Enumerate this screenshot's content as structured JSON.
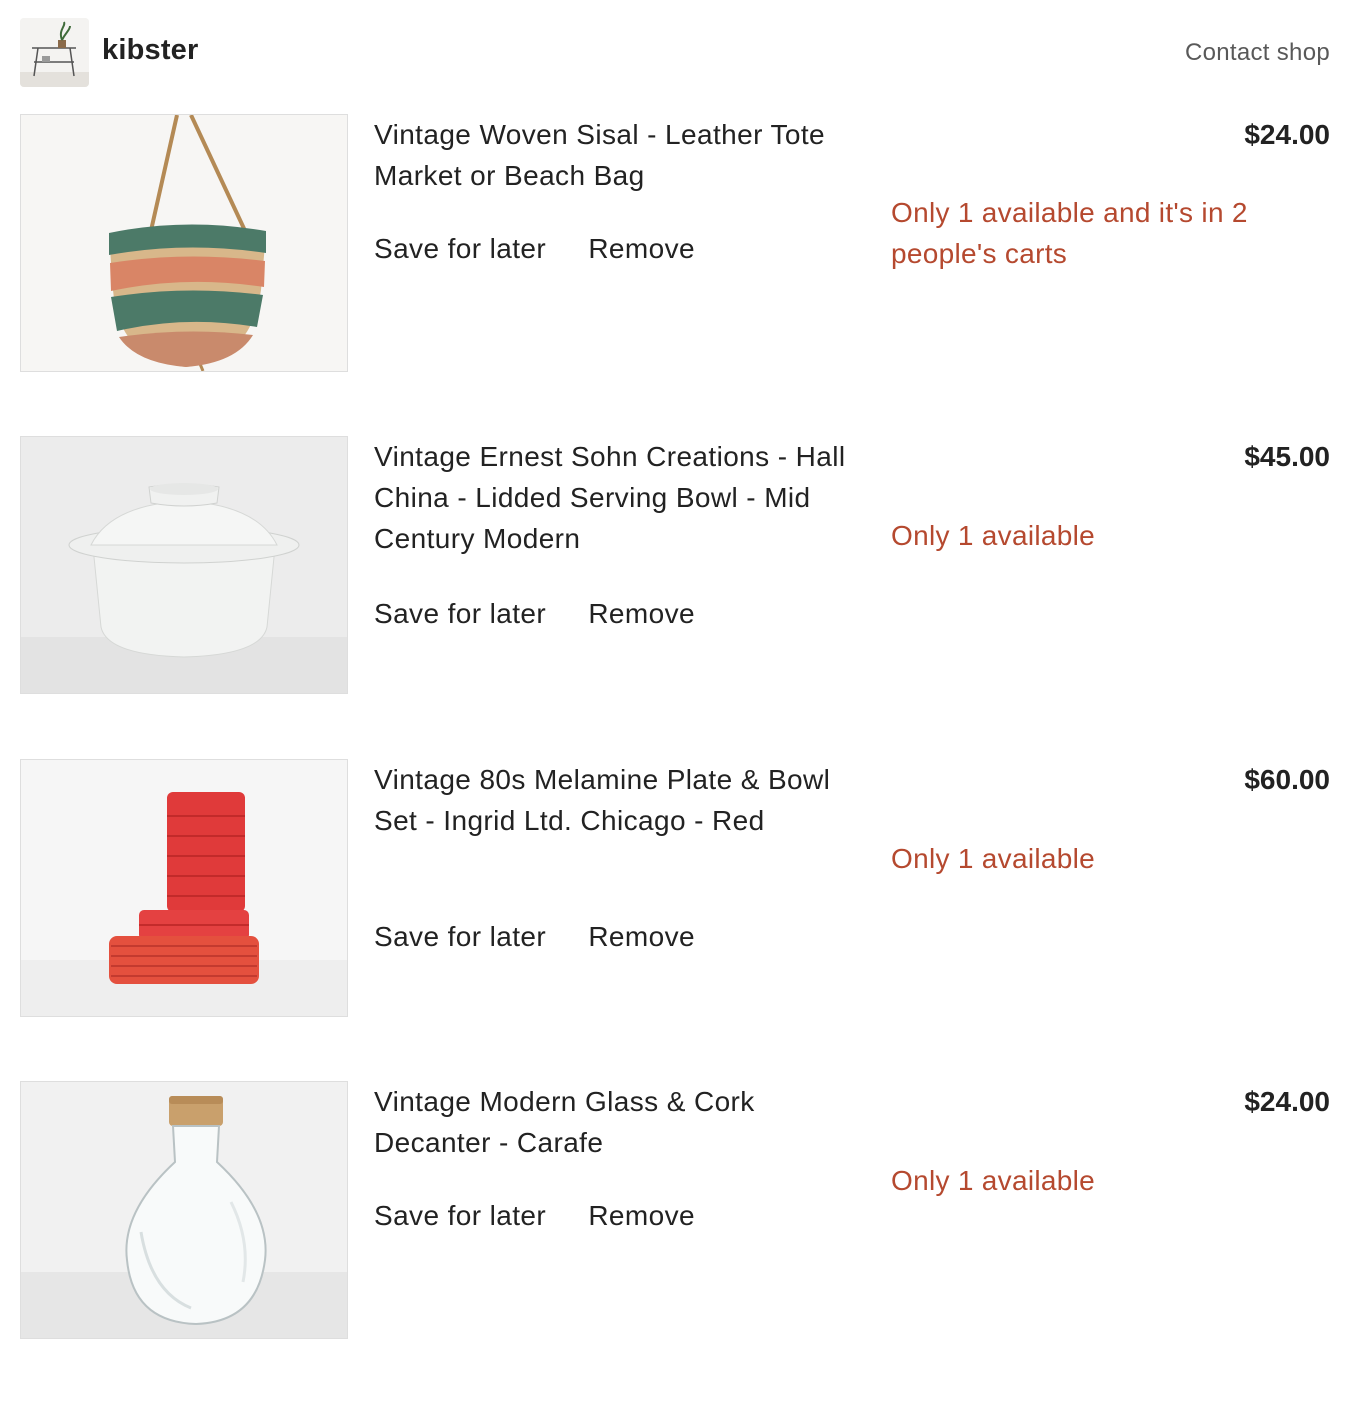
{
  "shop": {
    "name": "kibster",
    "contact_label": "Contact shop"
  },
  "items": [
    {
      "title": "Vintage Woven Sisal - Leather Tote Market or Beach Bag",
      "price": "$24.00",
      "availability": "Only 1 available and it's in 2 people's carts",
      "save_label": "Save for later",
      "remove_label": "Remove",
      "image_icon": "woven-bag-icon"
    },
    {
      "title": "Vintage Ernest Sohn Creations - Hall China - Lidded Serving Bowl - Mid Century Modern",
      "price": "$45.00",
      "availability": "Only 1 available",
      "save_label": "Save for later",
      "remove_label": "Remove",
      "image_icon": "lidded-bowl-icon"
    },
    {
      "title": "Vintage 80s Melamine Plate & Bowl Set - Ingrid Ltd. Chicago - Red",
      "price": "$60.00",
      "availability": "Only 1 available",
      "save_label": "Save for later",
      "remove_label": "Remove",
      "image_icon": "red-dish-stack-icon"
    },
    {
      "title": "Vintage Modern Glass & Cork Decanter - Carafe",
      "price": "$24.00",
      "availability": "Only 1 available",
      "save_label": "Save for later",
      "remove_label": "Remove",
      "image_icon": "glass-decanter-icon"
    }
  ],
  "colors": {
    "availability": "#b5492f",
    "text": "#222222",
    "muted": "#595959",
    "border": "#dedede"
  }
}
